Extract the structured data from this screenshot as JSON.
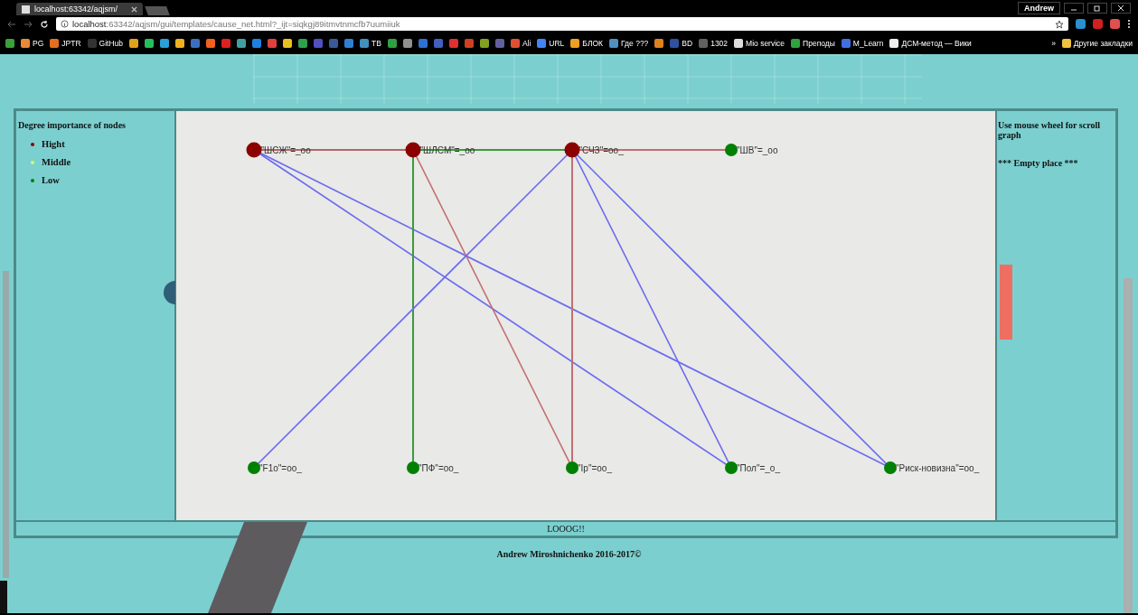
{
  "browser": {
    "tab": {
      "title": "localhost:63342/aqjsm/"
    },
    "profile": "Andrew",
    "url_host": "localhost",
    "url_rest": ":63342/aqjsm/gui/templates/cause_net.html?_ijt=siqkgj89itmvtnmcfb7uumiiuk",
    "bookmarks": [
      {
        "color": "#3aa03a"
      },
      {
        "label": "PG",
        "color": "#e8893a"
      },
      {
        "label": "JPTR",
        "color": "#e07020"
      },
      {
        "label": "GitHub",
        "color": "#333333"
      },
      {
        "color": "#e0a020"
      },
      {
        "color": "#25c05a"
      },
      {
        "color": "#2a9fd8"
      },
      {
        "color": "#f0b020"
      },
      {
        "color": "#3a70c0"
      },
      {
        "color": "#f06020"
      },
      {
        "color": "#e02020"
      },
      {
        "color": "#40a0a0"
      },
      {
        "color": "#2080e0"
      },
      {
        "color": "#e04040"
      },
      {
        "color": "#e8c020"
      },
      {
        "color": "#30a050"
      },
      {
        "color": "#5050c0"
      },
      {
        "color": "#3b5998"
      },
      {
        "color": "#3080d0"
      },
      {
        "label": "TB",
        "color": "#4090c0"
      },
      {
        "color": "#30a040"
      },
      {
        "color": "#909090"
      },
      {
        "color": "#3070d0"
      },
      {
        "color": "#4060c0"
      },
      {
        "color": "#e03030"
      },
      {
        "color": "#d04020"
      },
      {
        "color": "#80a020"
      },
      {
        "color": "#6060a0"
      },
      {
        "label": "Ali",
        "color": "#e05030"
      },
      {
        "label": "URL",
        "color": "#4285f4"
      },
      {
        "label": "БЛОК",
        "color": "#f0a020"
      },
      {
        "label": "Где ???",
        "color": "#5090c0"
      },
      {
        "color": "#e08020"
      },
      {
        "label": "BD",
        "color": "#3050a0"
      },
      {
        "label": "1302",
        "color": "#606060"
      },
      {
        "label": "Mio service",
        "color": "#dddddd"
      },
      {
        "label": "Преподы",
        "color": "#30a040"
      },
      {
        "label": "M_Learn",
        "color": "#4070e0"
      },
      {
        "label": "ДСМ-метод — Вики",
        "color": "#eeeeee"
      }
    ],
    "more": "»",
    "other_bookmarks": "Другие закладки"
  },
  "legend": {
    "title": "Degree importance of nodes",
    "items": [
      {
        "label": "Hight",
        "color": "#8b0000"
      },
      {
        "label": "Middle",
        "color": "#ccff66"
      },
      {
        "label": "Low",
        "color": "#008000"
      }
    ]
  },
  "graph": {
    "top_nodes": [
      {
        "label": "\"ШСЖ\"=_oo",
        "color": "#8b0000",
        "link_next": {
          "color": "#b06868"
        },
        "links_down": {
          "to_bottom_3": {
            "color": "#6a6af0"
          },
          "to_bottom_4": {
            "color": "#6a6af0"
          }
        }
      },
      {
        "label": "\"ШЛСМ\"=_oo",
        "color": "#8b0000",
        "link_next": {
          "color": "#3c9a3c"
        },
        "links_down": {
          "to_bottom_1": {
            "color": "#3c9a3c"
          },
          "to_bottom_2": {
            "color": "#c07070"
          }
        }
      },
      {
        "label": "\"СЧЗ\"=oo_",
        "color": "#8b0000",
        "link_next": {
          "color": "#c07070"
        },
        "links_down": {
          "to_bottom_0": {
            "color": "#6a6af0"
          },
          "to_bottom_2": {
            "color": "#c07070"
          },
          "to_bottom_3": {
            "color": "#6a6af0"
          },
          "to_bottom_4": {
            "color": "#6a6af0"
          }
        }
      },
      {
        "label": "\"ШВ\"=_oo",
        "color": "#008000"
      }
    ],
    "bottom_nodes": [
      {
        "label": "\"F1o\"=oo_",
        "color": "#008000"
      },
      {
        "label": "\"ПФ\"=oo_",
        "color": "#008000"
      },
      {
        "label": "\"Ip\"=oo_",
        "color": "#008000"
      },
      {
        "label": "\"Пол\"=_o_",
        "color": "#008000"
      },
      {
        "label": "\"Риск-новизна\"=oo_",
        "color": "#008000"
      }
    ]
  },
  "info": {
    "hint": "Use mouse wheel for scroll graph",
    "empty": "*** Empty place ***"
  },
  "log": "LOOOG!!",
  "footer": "Andrew Miroshnichenko 2016-2017©"
}
